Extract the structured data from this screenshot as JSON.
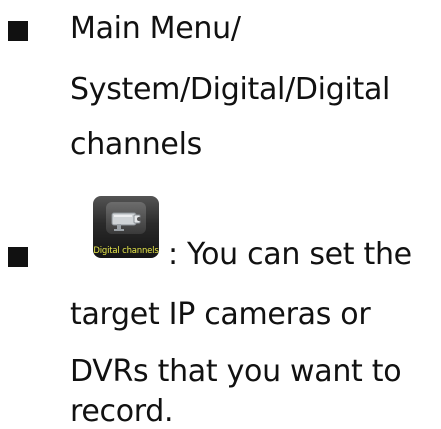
{
  "bullets": [
    {
      "lines": [
        "Main Menu/",
        "System/Digital/Digital",
        "channels"
      ]
    },
    {
      "icon_label": "Digital channels",
      "icon_name": "ip-camera-icon",
      "lines": [
        ": You can set the",
        "target IP cameras or",
        "DVRs that you want to",
        "record."
      ]
    }
  ],
  "colors": {
    "text": "#111111",
    "icon_label": "#e8e84a",
    "icon_bg": "#2a2a2a"
  }
}
